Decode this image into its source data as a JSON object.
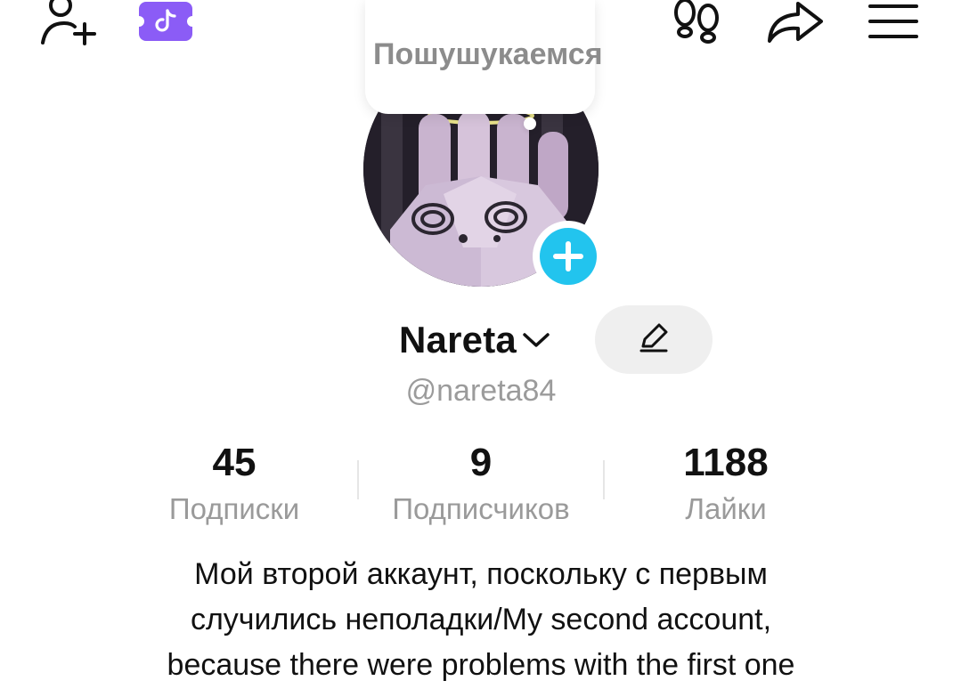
{
  "header": {
    "icons": [
      "add-friend-icon",
      "tiktok-badge-icon",
      "footprints-icon",
      "share-icon",
      "menu-icon"
    ]
  },
  "bubble": {
    "text": "Пошушукаемся"
  },
  "profile": {
    "name": "Nareta",
    "handle": "@nareta84",
    "accent": "#22c4ee"
  },
  "stats": [
    {
      "value": "45",
      "label": "Подписки"
    },
    {
      "value": "9",
      "label": "Подписчиков"
    },
    {
      "value": "1188",
      "label": "Лайки"
    }
  ],
  "bio": {
    "lines": [
      "Мой второй аккаунт, поскольку с первым",
      "случились неполадки/My second account,",
      "because there were problems with the first one"
    ]
  }
}
